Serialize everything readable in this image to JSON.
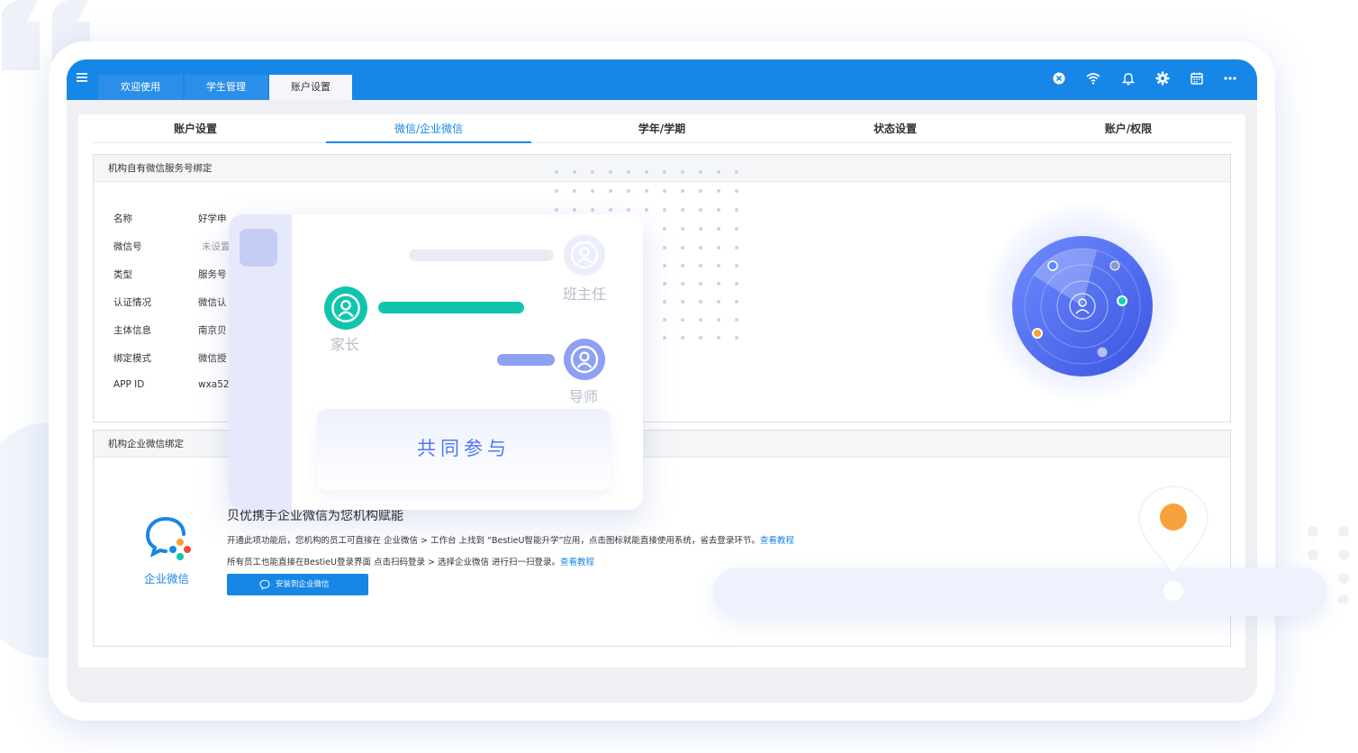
{
  "tabs": [
    {
      "label": "欢迎使用",
      "active": false
    },
    {
      "label": "学生管理",
      "active": false
    },
    {
      "label": "账户设置",
      "active": true
    }
  ],
  "top_icons": [
    "close-circle-icon",
    "wifi-icon",
    "bell-icon",
    "gear-icon",
    "calendar-icon",
    "more-icon"
  ],
  "subtabs": [
    {
      "label": "账户设置",
      "active": false
    },
    {
      "label": "微信/企业微信",
      "active": true
    },
    {
      "label": "学年/学期",
      "active": false
    },
    {
      "label": "状态设置",
      "active": false
    },
    {
      "label": "账户/权限",
      "active": false
    }
  ],
  "wechat_section": {
    "title": "机构自有微信服务号绑定",
    "fields": [
      {
        "label": "名称",
        "value": "好学申"
      },
      {
        "label": "微信号",
        "value": "未设置"
      },
      {
        "label": "类型",
        "value": "服务号"
      },
      {
        "label": "认证情况",
        "value": "微信认"
      },
      {
        "label": "主体信息",
        "value": "南京贝"
      },
      {
        "label": "绑定模式",
        "value": "微信授"
      },
      {
        "label": "APP ID",
        "value": "wxa52"
      }
    ]
  },
  "wecom_section": {
    "title": "机构企业微信绑定",
    "logo_label": "企业微信",
    "headline": "贝优携手企业微信为您机构赋能",
    "line1": "开通此项功能后，您机构的员工可直接在 企业微信 > 工作台 上找到 “BestieU智能升学”应用，点击图标就能直接使用系统，省去登录环节。",
    "line1_link": "查看教程",
    "line2": "所有员工也能直接在BestieU登录界面 点击扫码登录 > 选择企业微信 进行扫一扫登录。",
    "line2_link": "查看教程",
    "install_button": "安装到企业微信"
  },
  "overlay_card": {
    "roles": [
      {
        "label": "班主任"
      },
      {
        "label": "家长"
      },
      {
        "label": "导师"
      }
    ],
    "cta": "共同参与"
  },
  "colors": {
    "primary": "#1687e6",
    "teal": "#10c5ad",
    "indigo": "#4e78ee",
    "orange": "#f7a23c"
  }
}
